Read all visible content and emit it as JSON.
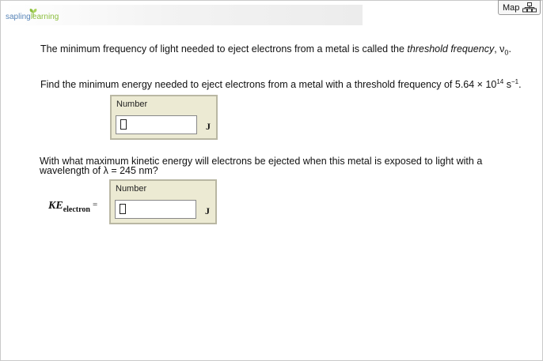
{
  "header": {
    "logo_part1": "sapling",
    "logo_part2": "learning",
    "map_label": "Map"
  },
  "question": {
    "intro_text": "The minimum frequency of light needed to eject electrons from a metal is called the ",
    "intro_term": "threshold frequency",
    "intro_tail": ", ν",
    "intro_sub": "0",
    "intro_end": ".",
    "part1_text": "Find the minimum energy needed to eject electrons from a metal with a threshold frequency of 5.64 × 10",
    "part1_exp": "14",
    "part1_unit": " s",
    "part1_unit_exp": "−1",
    "part1_end": ".",
    "part2_line1": "With what maximum kinetic energy will electrons be ejected when this metal is exposed to light with a",
    "part2_line2": "wavelength of λ = 245 nm?"
  },
  "answers": [
    {
      "label": "Number",
      "value": "",
      "unit": "J"
    },
    {
      "label": "Number",
      "value": "",
      "unit": "J"
    }
  ],
  "ke_label": {
    "main": "KE",
    "sub": "electron",
    "eq": "="
  },
  "colors": {
    "box_bg": "#ecead3",
    "logo_blue": "#5a86b8",
    "logo_green": "#8cbf3f"
  }
}
